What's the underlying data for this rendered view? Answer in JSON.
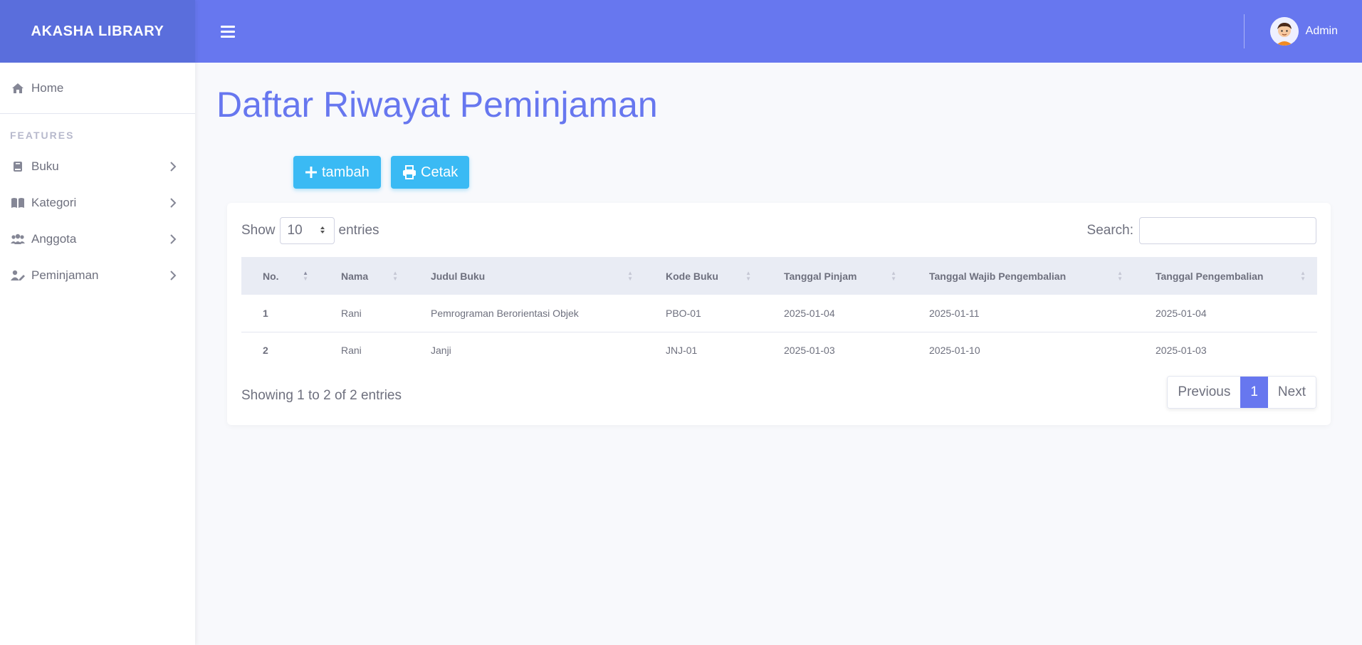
{
  "brand": {
    "title": "AKASHA LIBRARY",
    "color": "#5a6edc"
  },
  "topbar": {
    "color": "#6777ef",
    "user_name": "Admin"
  },
  "sidebar": {
    "home_label": "Home",
    "section_label": "FEATURES",
    "items": [
      {
        "label": "Buku",
        "icon": "book-icon"
      },
      {
        "label": "Kategori",
        "icon": "book-open-icon"
      },
      {
        "label": "Anggota",
        "icon": "users-icon"
      },
      {
        "label": "Peminjaman",
        "icon": "user-edit-icon"
      }
    ]
  },
  "page": {
    "title": "Daftar Riwayat Peminjaman",
    "add_label": "tambah",
    "print_label": "Cetak"
  },
  "table_controls": {
    "show_label": "Show",
    "entries_value": "10",
    "entries_label": "entries",
    "search_label": "Search:",
    "search_value": "",
    "info": "Showing 1 to 2 of 2 entries",
    "prev_label": "Previous",
    "current_page": "1",
    "next_label": "Next"
  },
  "table": {
    "columns": [
      "No.",
      "Nama",
      "Judul Buku",
      "Kode Buku",
      "Tanggal Pinjam",
      "Tanggal Wajib Pengembalian",
      "Tanggal Pengembalian"
    ],
    "rows": [
      [
        "1",
        "Rani",
        "Pemrograman Berorientasi Objek",
        "PBO-01",
        "2025-01-04",
        "2025-01-11",
        "2025-01-04"
      ],
      [
        "2",
        "Rani",
        "Janji",
        "JNJ-01",
        "2025-01-03",
        "2025-01-10",
        "2025-01-03"
      ]
    ]
  },
  "colors": {
    "accent": "#6777ef",
    "button": "#3abaf4",
    "background": "#f8f9fc"
  }
}
